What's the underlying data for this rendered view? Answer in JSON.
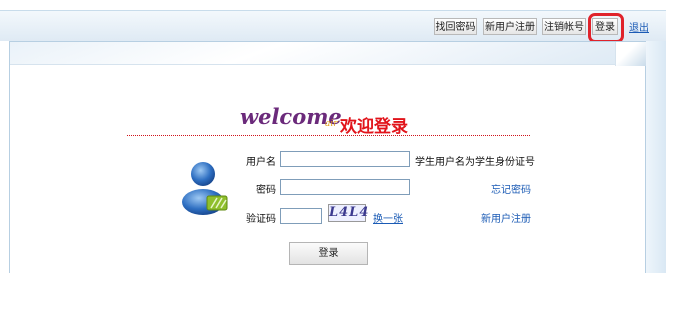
{
  "toolbar": {
    "find_password": "找回密码",
    "new_user_register": "新用户注册",
    "cancel_account": "注销帐号",
    "login": "登录",
    "logout": "退出"
  },
  "welcome": {
    "logo_text": "welcome",
    "logo_sub": "air",
    "title": "欢迎登录"
  },
  "form": {
    "username_label": "用户名",
    "username_value": "",
    "username_hint": "学生用户名为学生身份证号",
    "password_label": "密码",
    "password_value": "",
    "forgot_password": "忘记密码",
    "captcha_label": "验证码",
    "captcha_value": "",
    "captcha_text": "L4L4",
    "refresh_captcha": "换一张",
    "register_link": "新用户注册",
    "submit_label": "登录"
  },
  "colors": {
    "accent_red": "#e1141b",
    "link_blue": "#1b5bb5",
    "logo_purple": "#6b2a7b",
    "highlight": "#e0232b"
  }
}
